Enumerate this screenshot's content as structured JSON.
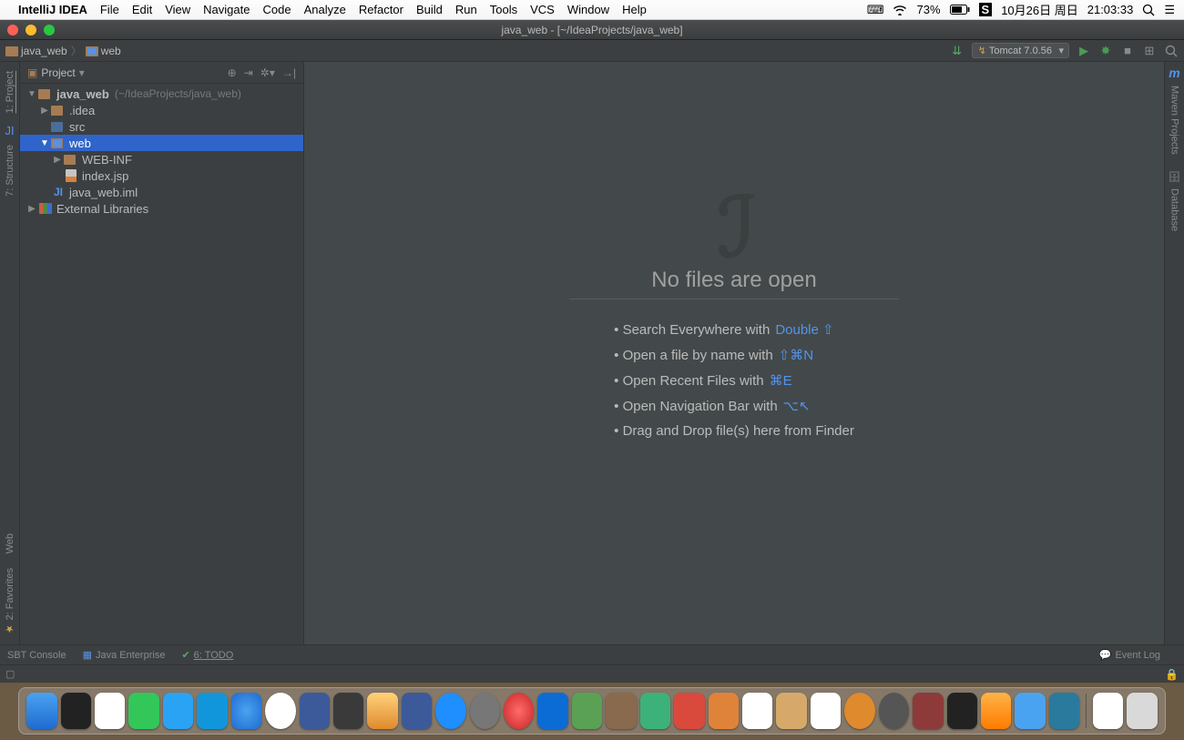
{
  "mac_menu": {
    "app": "IntelliJ IDEA",
    "items": [
      "File",
      "Edit",
      "View",
      "Navigate",
      "Code",
      "Analyze",
      "Refactor",
      "Build",
      "Run",
      "Tools",
      "VCS",
      "Window",
      "Help"
    ],
    "battery": "73%",
    "date": "10月26日 周日",
    "time": "21:03:33"
  },
  "window": {
    "title": "java_web - [~/IdeaProjects/java_web]"
  },
  "breadcrumb": {
    "a": "java_web",
    "b": "web"
  },
  "toolbar": {
    "run_config": "Tomcat 7.0.56"
  },
  "sidebar": {
    "title": "Project"
  },
  "tree": {
    "root": {
      "name": "java_web",
      "hint": "(~/IdeaProjects/java_web)"
    },
    "idea": ".idea",
    "src": "src",
    "web": "web",
    "webinf": "WEB-INF",
    "index": "index.jsp",
    "iml": "java_web.iml",
    "ext": "External Libraries"
  },
  "left_tabs": {
    "project": "1: Project",
    "structure": "7: Structure",
    "web": "Web",
    "fav": "2: Favorites"
  },
  "right_tabs": {
    "maven": "Maven Projects",
    "database": "Database",
    "m": "m"
  },
  "welcome": {
    "title": "No files are open",
    "tips": [
      {
        "text": "Search Everywhere with",
        "shortcut": "Double ⇧"
      },
      {
        "text": "Open a file by name with",
        "shortcut": "⇧⌘N"
      },
      {
        "text": "Open Recent Files with",
        "shortcut": "⌘E"
      },
      {
        "text": "Open Navigation Bar with",
        "shortcut": "⌥↖"
      },
      {
        "text": "Drag and Drop file(s) here from Finder",
        "shortcut": ""
      }
    ]
  },
  "bottom": {
    "sbt": "SBT Console",
    "java_ee": "Java Enterprise",
    "todo": "6: TODO",
    "event_log": "Event Log"
  }
}
